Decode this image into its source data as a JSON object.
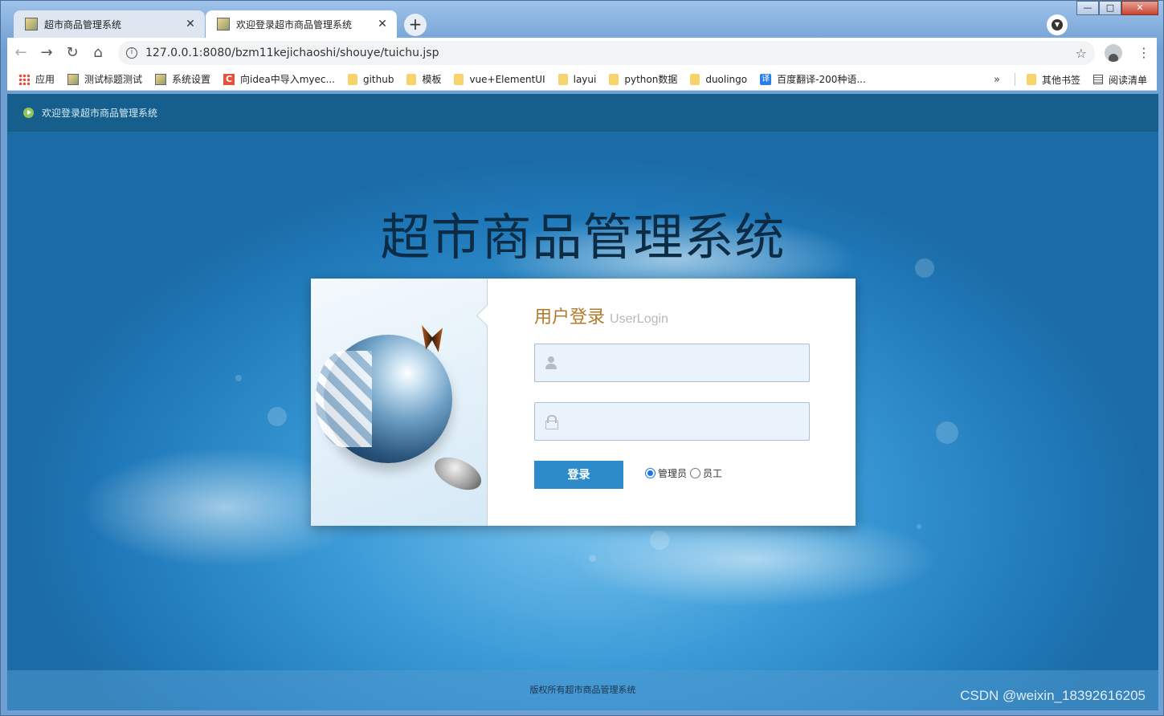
{
  "window": {
    "minimize": "—",
    "maximize": "□",
    "close": "✕"
  },
  "tabs": [
    {
      "title": "超市商品管理系统",
      "close": "✕",
      "active": false
    },
    {
      "title": "欢迎登录超市商品管理系统",
      "close": "✕",
      "active": true
    }
  ],
  "new_tab": "+",
  "toolbar": {
    "back": "←",
    "forward": "→",
    "reload": "↻",
    "home": "⌂",
    "info": "i",
    "url": "127.0.0.1:8080/bzm11kejichaoshi/shouye/tuichu.jsp",
    "bookmark_star": "☆",
    "menu": "⋮"
  },
  "bookmarks": {
    "items": [
      {
        "label": "应用",
        "icon": "apps-icon"
      },
      {
        "label": "测试标题测试",
        "icon": "page-icon"
      },
      {
        "label": "系统设置",
        "icon": "page-icon"
      },
      {
        "label": "向idea中导入myec...",
        "icon": "csdn-icon"
      },
      {
        "label": "github",
        "icon": "folder-icon"
      },
      {
        "label": "模板",
        "icon": "folder-icon"
      },
      {
        "label": "vue+ElementUI",
        "icon": "folder-icon"
      },
      {
        "label": "layui",
        "icon": "folder-icon"
      },
      {
        "label": "python数据",
        "icon": "folder-icon"
      },
      {
        "label": "duolingo",
        "icon": "folder-icon"
      },
      {
        "label": "百度翻译-200种语...",
        "icon": "translate-icon"
      }
    ],
    "more": "»",
    "other": "其他书签",
    "reading_list": "阅读清单",
    "csdn_glyph": "C",
    "translate_glyph": "译"
  },
  "page": {
    "welcome": "欢迎登录超市商品管理系统",
    "system_title": "超市商品管理系统",
    "login": {
      "heading_zh": "用户登录",
      "heading_en": "UserLogin",
      "username_value": "",
      "password_value": "",
      "button": "登录",
      "roles": [
        {
          "label": "管理员",
          "checked": true
        },
        {
          "label": "员工",
          "checked": false
        }
      ]
    },
    "footer": "版权所有超市商品管理系统"
  },
  "watermark": "CSDN @weixin_18392616205",
  "colors": {
    "accent_button": "#2d8bc9",
    "heading": "#b07b2c",
    "topbar": "#165f8c"
  }
}
